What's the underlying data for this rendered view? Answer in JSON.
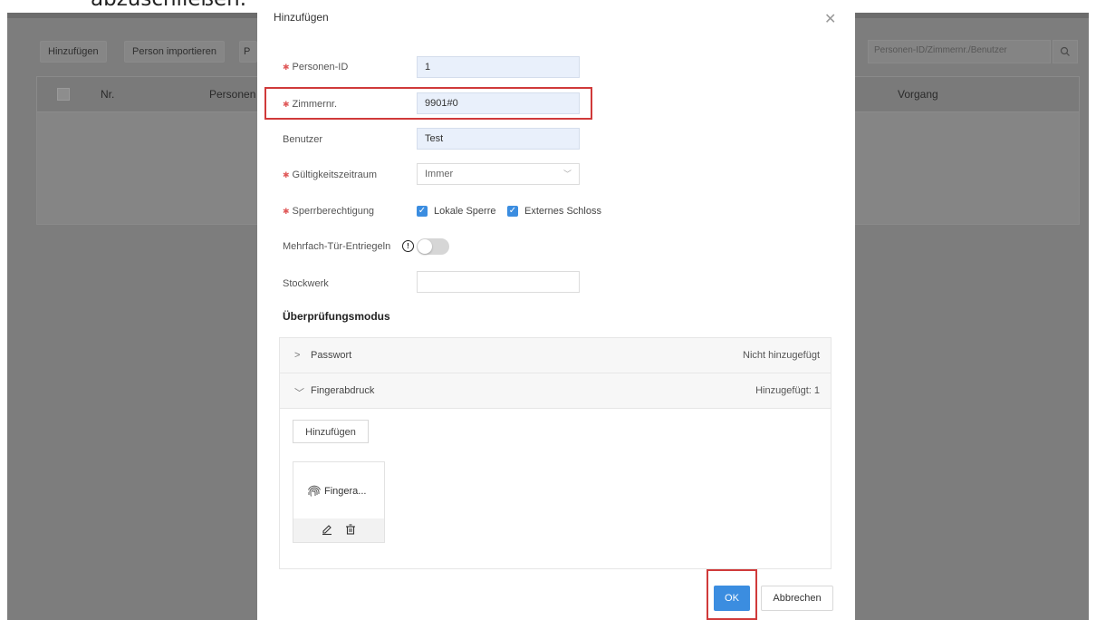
{
  "doc": {
    "top_text": "abzuschließen."
  },
  "background": {
    "toolbar": {
      "add_label": "Hinzufügen",
      "import_label": "Person importieren",
      "partial_label": "P"
    },
    "search": {
      "placeholder": "Personen-ID/Zimmernr./Benutzer",
      "icon": "search-icon"
    },
    "table": {
      "columns": [
        "Nr.",
        "Personen",
        "Vorgang"
      ]
    }
  },
  "modal": {
    "title": "Hinzufügen",
    "close_icon": "close-icon",
    "fields": {
      "person_id": {
        "label": "Personen-ID",
        "value": "1",
        "required": true
      },
      "room_no": {
        "label": "Zimmernr.",
        "value": "9901#0",
        "required": true
      },
      "user": {
        "label": "Benutzer",
        "value": "Test",
        "required": false
      },
      "validity": {
        "label": "Gültigkeitszeitraum",
        "value": "Immer",
        "required": true
      },
      "lock_permission": {
        "label": "Sperrberechtigung",
        "required": true,
        "options": [
          {
            "label": "Lokale Sperre",
            "checked": true
          },
          {
            "label": "Externes Schloss",
            "checked": true
          }
        ]
      },
      "multi_door": {
        "label": "Mehrfach-Tür-Entriegeln",
        "enabled": false
      },
      "floor": {
        "label": "Stockwerk",
        "value": ""
      }
    },
    "verification": {
      "title": "Überprüfungsmodus",
      "password": {
        "label": "Passwort",
        "status": "Nicht hinzugefügt",
        "expanded": false
      },
      "fingerprint": {
        "label": "Fingerabdruck",
        "status": "Hinzugefügt: 1",
        "expanded": true,
        "add_label": "Hinzufügen",
        "card_name": "Fingera..."
      }
    },
    "buttons": {
      "ok": "OK",
      "cancel": "Abbrechen"
    }
  },
  "colors": {
    "accent": "#3b8de0",
    "highlight": "#d03a3a",
    "required": "#e05a5a"
  }
}
